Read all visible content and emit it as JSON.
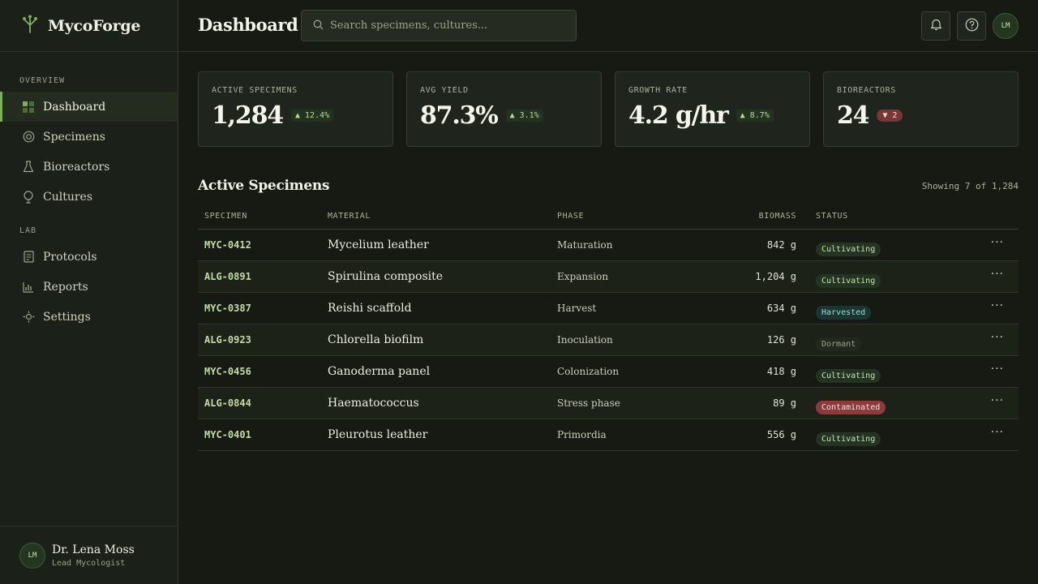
{
  "app": {
    "name": "MycoForge"
  },
  "sidebar": {
    "sections": [
      {
        "label": "OVERVIEW"
      },
      {
        "label": "LAB"
      }
    ],
    "items": [
      {
        "label": "Dashboard",
        "icon": "grid-icon"
      },
      {
        "label": "Specimens",
        "icon": "target-icon"
      },
      {
        "label": "Bioreactors",
        "icon": "flask-icon"
      },
      {
        "label": "Cultures",
        "icon": "bulb-icon"
      },
      {
        "label": "Protocols",
        "icon": "document-icon"
      },
      {
        "label": "Reports",
        "icon": "bar-chart-icon"
      },
      {
        "label": "Settings",
        "icon": "gear-icon"
      }
    ],
    "user": {
      "initials": "LM",
      "name": "Dr. Lena Moss",
      "role": "Lead Mycologist"
    }
  },
  "header": {
    "title": "Dashboard",
    "search_placeholder": "Search specimens, cultures...",
    "avatar_initials": "LM"
  },
  "stats": [
    {
      "label": "ACTIVE SPECIMENS",
      "value": "1,284",
      "delta": "▲ 12.4%",
      "direction": "up"
    },
    {
      "label": "AVG YIELD",
      "value": "87.3%",
      "delta": "▲ 3.1%",
      "direction": "up"
    },
    {
      "label": "GROWTH RATE",
      "value": "4.2 g/hr",
      "delta": "▲ 8.7%",
      "direction": "up"
    },
    {
      "label": "BIOREACTORS",
      "value": "24",
      "delta": "▼ 2",
      "direction": "down"
    }
  ],
  "table": {
    "title": "Active Specimens",
    "showing": "Showing 7 of 1,284",
    "columns": [
      "SPECIMEN",
      "MATERIAL",
      "PHASE",
      "BIOMASS",
      "STATUS"
    ],
    "rows": [
      {
        "id": "MYC-0412",
        "material": "Mycelium leather",
        "phase": "Maturation",
        "biomass": "842 g",
        "status": "Cultivating",
        "status_type": "cultivating"
      },
      {
        "id": "ALG-0891",
        "material": "Spirulina composite",
        "phase": "Expansion",
        "biomass": "1,204 g",
        "status": "Cultivating",
        "status_type": "cultivating"
      },
      {
        "id": "MYC-0387",
        "material": "Reishi scaffold",
        "phase": "Harvest",
        "biomass": "634 g",
        "status": "Harvested",
        "status_type": "harvested"
      },
      {
        "id": "ALG-0923",
        "material": "Chlorella biofilm",
        "phase": "Inoculation",
        "biomass": "126 g",
        "status": "Dormant",
        "status_type": "dormant"
      },
      {
        "id": "MYC-0456",
        "material": "Ganoderma panel",
        "phase": "Colonization",
        "biomass": "418 g",
        "status": "Cultivating",
        "status_type": "cultivating"
      },
      {
        "id": "ALG-0844",
        "material": "Haematococcus",
        "phase": "Stress phase",
        "biomass": "89 g",
        "status": "Contaminated",
        "status_type": "contaminated"
      },
      {
        "id": "MYC-0401",
        "material": "Pleurotus leather",
        "phase": "Primordia",
        "biomass": "556 g",
        "status": "Cultivating",
        "status_type": "cultivating"
      }
    ],
    "more_label": "···"
  },
  "colors": {
    "accent": "#7fae5a",
    "background": "#161a13",
    "sidebar": "#1b2018",
    "danger": "#8c3a3a",
    "harvested": "#183633"
  }
}
